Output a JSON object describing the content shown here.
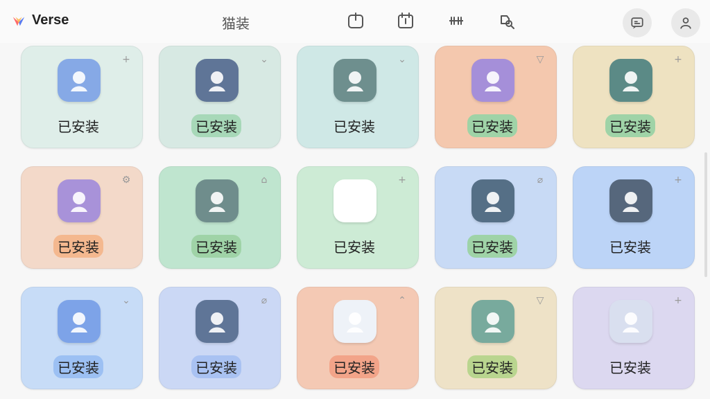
{
  "app": {
    "title": "Verse"
  },
  "header": {
    "center_title": "猫装",
    "icons": [
      "power-icon",
      "calendar-icon",
      "dumbbell-icon",
      "puzzle-search-icon"
    ],
    "right_buttons": [
      "message-icon",
      "user-icon"
    ]
  },
  "cards": [
    {
      "label": "已安装",
      "bg": "#dfeee9",
      "corner": "+",
      "icon": "user-icon",
      "icon_bg": "#86a9e6",
      "label_bg": ""
    },
    {
      "label": "已安装",
      "bg": "#d7e9e3",
      "corner": "⌄",
      "icon": "pencil-icon",
      "icon_bg": "#5f7597",
      "label_bg": "#a7d8b8"
    },
    {
      "label": "已安装",
      "bg": "#cfe8e6",
      "corner": "⌄",
      "icon": "ghost-icon",
      "icon_bg": "#6e8f8e",
      "label_bg": ""
    },
    {
      "label": "已安装",
      "bg": "#f4c8ae",
      "corner": "▽",
      "icon": "user-icon",
      "icon_bg": "#a58fd9",
      "label_bg": "#9fd3a7"
    },
    {
      "label": "已安装",
      "bg": "#eee2c1",
      "corner": "+",
      "icon": "ghost-icon",
      "icon_bg": "#5b8a86",
      "label_bg": "#9fd3a7"
    },
    {
      "label": "已安装",
      "bg": "#f3d9c9",
      "corner": "⚙",
      "icon": "user-icon",
      "icon_bg": "#a892d9",
      "label_bg": "#f4b88f"
    },
    {
      "label": "已安装",
      "bg": "#bfe5cf",
      "corner": "⌂",
      "icon": "arch-icon",
      "icon_bg": "#6f8d8c",
      "label_bg": "#9fd3a7"
    },
    {
      "label": "已安装",
      "bg": "#cdebd5",
      "corner": "+",
      "icon": "chat-icon",
      "icon_bg": "#ffffff",
      "label_bg": ""
    },
    {
      "label": "已安装",
      "bg": "#c8daf5",
      "corner": "⌀",
      "icon": "photo-icon",
      "icon_bg": "#556f86",
      "label_bg": "#9fd3a7"
    },
    {
      "label": "已安装",
      "bg": "#bcd4f7",
      "corner": "+",
      "icon": "download-ghost-icon",
      "icon_bg": "#56677c",
      "label_bg": ""
    },
    {
      "label": "已安装",
      "bg": "#c7dcf7",
      "corner": "⌄",
      "icon": "chat-bubble-icon",
      "icon_bg": "#7da3e8",
      "label_bg": "#9cc0f3"
    },
    {
      "label": "已安装",
      "bg": "#cbd8f5",
      "corner": "⌀",
      "icon": "trend-icon",
      "icon_bg": "#5f7597",
      "label_bg": "#a9c2f2"
    },
    {
      "label": "已安装",
      "bg": "#f4c9b4",
      "corner": "⌃",
      "icon": "grid-icon",
      "icon_bg": "#eef2f8",
      "label_bg": "#f2a489"
    },
    {
      "label": "已安装",
      "bg": "#eee2c7",
      "corner": "▽",
      "icon": "ghost-icon",
      "icon_bg": "#78aa9d",
      "label_bg": "#b9d58f"
    },
    {
      "label": "已安装",
      "bg": "#dcd8f0",
      "corner": "+",
      "icon": "palette-icon",
      "icon_bg": "#d9dfef",
      "label_bg": ""
    }
  ]
}
